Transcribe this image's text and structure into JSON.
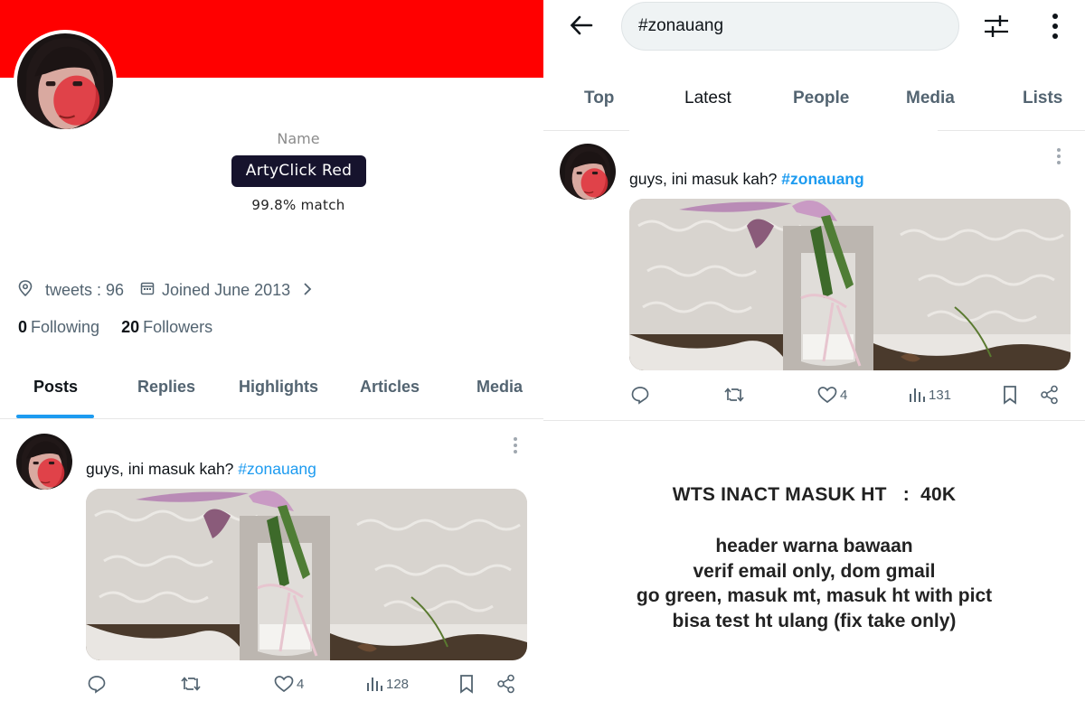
{
  "left_profile": {
    "name_caption": "Name",
    "color_name": "ArtyClick Red",
    "match_text": "99.8% match",
    "banner_color": "#ff0000",
    "meta": {
      "location_icon": "location-pin-icon",
      "location_text": "tweets : 96",
      "calendar_icon": "calendar-icon",
      "joined_text": "Joined June 2013"
    },
    "following_count": "0",
    "following_label": "Following",
    "followers_count": "20",
    "followers_label": "Followers",
    "tabs": [
      "Posts",
      "Replies",
      "Highlights",
      "Articles",
      "Media"
    ],
    "active_tab": "Posts",
    "tweet": {
      "text": "guys, ini masuk kah? ",
      "hashtag": "#zonauang",
      "likes": "4",
      "views": "128"
    }
  },
  "right_search": {
    "search_query": "#zonauang",
    "tabs": [
      "Top",
      "Latest",
      "People",
      "Media",
      "Lists"
    ],
    "active_tab": "Latest",
    "tweet": {
      "text": "guys, ini masuk kah? ",
      "hashtag": "#zonauang",
      "likes": "4",
      "views": "131"
    },
    "wts": {
      "title": "WTS INACT MASUK HT   :  40K",
      "lines": [
        "header warna bawaan",
        "verif email only, dom gmail",
        "go green, masuk mt, masuk ht with pict",
        "bisa test ht ulang (fix take only)"
      ]
    }
  },
  "colors": {
    "accent": "#1d9bf0",
    "pill_bg": "#16132d",
    "muted": "#536471"
  }
}
